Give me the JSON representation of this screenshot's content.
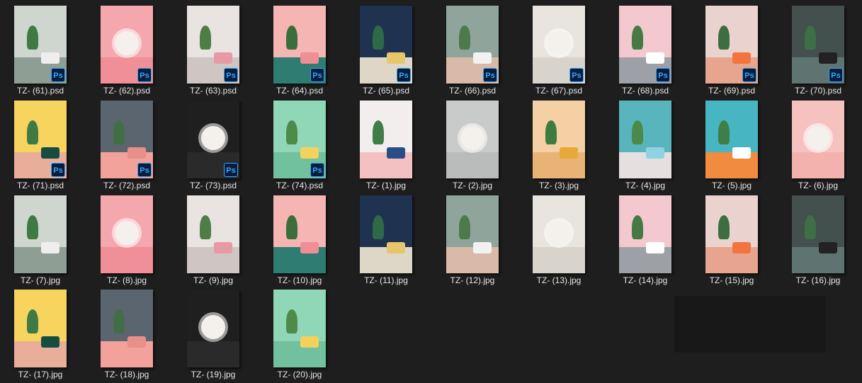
{
  "colors": {
    "background": "#1e1e1e",
    "label_text": "#e6e6e6",
    "ps_badge_bg": "#0a1c3c",
    "ps_badge_fg": "#31a8ff"
  },
  "files": [
    {
      "name": "TZ- (61).psd",
      "ps": true,
      "bg": "#cfd6cf",
      "floor": "#8f9e94",
      "plant": "#3f7a44",
      "obj": "#eeeeee"
    },
    {
      "name": "TZ- (62).psd",
      "ps": true,
      "bg": "#f4a7ad",
      "floor": "#f08f98",
      "plant": "#4e8a48",
      "obj": "#ffffff",
      "plate": true
    },
    {
      "name": "TZ- (63).psd",
      "ps": true,
      "bg": "#e9e3e1",
      "floor": "#cfc6c4",
      "plant": "#4f7d46",
      "obj": "#e59aa5"
    },
    {
      "name": "TZ- (64).psd",
      "ps": true,
      "bg": "#f5b5b2",
      "floor": "#2f7c72",
      "plant": "#3b6e3c",
      "obj": "#f08e96"
    },
    {
      "name": "TZ- (65).psd",
      "ps": true,
      "bg": "#1f3350",
      "floor": "#ded6c6",
      "plant": "#2e6a48",
      "obj": "#e7c66a"
    },
    {
      "name": "TZ- (66).psd",
      "ps": true,
      "bg": "#8fa59c",
      "floor": "#d9b9a8",
      "plant": "#4c7a4b",
      "obj": "#f2f2f2"
    },
    {
      "name": "TZ- (67).psd",
      "ps": true,
      "bg": "#e8e5de",
      "floor": "#d8d4cc",
      "plant": "#e9c53d",
      "obj": "#f5f5f5",
      "plate": true
    },
    {
      "name": "TZ- (68).psd",
      "ps": true,
      "bg": "#f3c9cf",
      "floor": "#9da0a6",
      "plant": "#467a45",
      "obj": "#ffffff"
    },
    {
      "name": "TZ- (69).psd",
      "ps": true,
      "bg": "#ead3cf",
      "floor": "#e7a58f",
      "plant": "#3d6d40",
      "obj": "#f3743f"
    },
    {
      "name": "TZ- (70).psd",
      "ps": true,
      "bg": "#43504e",
      "floor": "#5f7470",
      "plant": "#3f6f46",
      "obj": "#222222"
    },
    {
      "name": "TZ- (71).psd",
      "ps": true,
      "bg": "#f7d45d",
      "floor": "#e8ae9a",
      "plant": "#3d7a46",
      "obj": "#174d41"
    },
    {
      "name": "TZ- (72).psd",
      "ps": true,
      "bg": "#5b6570",
      "floor": "#f2a19b",
      "plant": "#426e46",
      "obj": "#e98f8a"
    },
    {
      "name": "TZ- (73).psd",
      "ps": true,
      "bg": "#1f1f1f",
      "floor": "#2a2a2a",
      "plant": "#3d6a3e",
      "obj": "#c9a43c",
      "plate": true
    },
    {
      "name": "TZ- (74).psd",
      "ps": true,
      "bg": "#8fd7b7",
      "floor": "#71c09e",
      "plant": "#4e8a48",
      "obj": "#f3d25b"
    },
    {
      "name": "TZ- (1).jpg",
      "ps": false,
      "bg": "#f3eeee",
      "floor": "#f4c1c3",
      "plant": "#3f7e49",
      "obj": "#2b4d86"
    },
    {
      "name": "TZ- (2).jpg",
      "ps": false,
      "bg": "#c9cbca",
      "floor": "#b9bcbb",
      "plant": "#3d7b46",
      "obj": "#dcdcdc",
      "plate": true
    },
    {
      "name": "TZ- (3).jpg",
      "ps": false,
      "bg": "#f4d0a4",
      "floor": "#e9b375",
      "plant": "#3e7b3e",
      "obj": "#e8a93a"
    },
    {
      "name": "TZ- (4).jpg",
      "ps": false,
      "bg": "#58b5be",
      "floor": "#e6dfe0",
      "plant": "#4b8a48",
      "obj": "#8ed3e4"
    },
    {
      "name": "TZ- (5).jpg",
      "ps": false,
      "bg": "#48b6c2",
      "floor": "#f08b3f",
      "plant": "#3f7e44",
      "obj": "#ffffff"
    },
    {
      "name": "TZ- (6).jpg",
      "ps": false,
      "bg": "#f6c2bf",
      "floor": "#f3b2ad",
      "plant": "#6b9a55",
      "obj": "#ffffff",
      "plate": true
    },
    {
      "name": "TZ- (7).jpg",
      "ps": false,
      "bg": "#cfd6cf",
      "floor": "#8f9e94",
      "plant": "#3f7a44",
      "obj": "#eeeeee"
    },
    {
      "name": "TZ- (8).jpg",
      "ps": false,
      "bg": "#f4a7ad",
      "floor": "#f08f98",
      "plant": "#4e8a48",
      "obj": "#ffffff",
      "plate": true
    },
    {
      "name": "TZ- (9).jpg",
      "ps": false,
      "bg": "#e9e3e1",
      "floor": "#cfc6c4",
      "plant": "#4f7d46",
      "obj": "#e59aa5"
    },
    {
      "name": "TZ- (10).jpg",
      "ps": false,
      "bg": "#f5b5b2",
      "floor": "#2f7c72",
      "plant": "#3b6e3c",
      "obj": "#f08e96"
    },
    {
      "name": "TZ- (11).jpg",
      "ps": false,
      "bg": "#1f3350",
      "floor": "#ded6c6",
      "plant": "#2e6a48",
      "obj": "#e7c66a"
    },
    {
      "name": "TZ- (12).jpg",
      "ps": false,
      "bg": "#8fa59c",
      "floor": "#d9b9a8",
      "plant": "#4c7a4b",
      "obj": "#f2f2f2"
    },
    {
      "name": "TZ- (13).jpg",
      "ps": false,
      "bg": "#e8e5de",
      "floor": "#d8d4cc",
      "plant": "#e9c53d",
      "obj": "#f5f5f5",
      "plate": true
    },
    {
      "name": "TZ- (14).jpg",
      "ps": false,
      "bg": "#f3c9cf",
      "floor": "#9da0a6",
      "plant": "#467a45",
      "obj": "#ffffff"
    },
    {
      "name": "TZ- (15).jpg",
      "ps": false,
      "bg": "#ead3cf",
      "floor": "#e7a58f",
      "plant": "#3d6d40",
      "obj": "#f3743f"
    },
    {
      "name": "TZ- (16).jpg",
      "ps": false,
      "bg": "#43504e",
      "floor": "#5f7470",
      "plant": "#3f6f46",
      "obj": "#222222"
    },
    {
      "name": "TZ- (17).jpg",
      "ps": false,
      "bg": "#f7d45d",
      "floor": "#e8ae9a",
      "plant": "#3d7a46",
      "obj": "#174d41"
    },
    {
      "name": "TZ- (18).jpg",
      "ps": false,
      "bg": "#5b6570",
      "floor": "#f2a19b",
      "plant": "#426e46",
      "obj": "#e98f8a"
    },
    {
      "name": "TZ- (19).jpg",
      "ps": false,
      "bg": "#1f1f1f",
      "floor": "#2a2a2a",
      "plant": "#3d6a3e",
      "obj": "#c9a43c",
      "plate": true
    },
    {
      "name": "TZ- (20).jpg",
      "ps": false,
      "bg": "#8fd7b7",
      "floor": "#71c09e",
      "plant": "#4e8a48",
      "obj": "#f3d25b"
    }
  ]
}
